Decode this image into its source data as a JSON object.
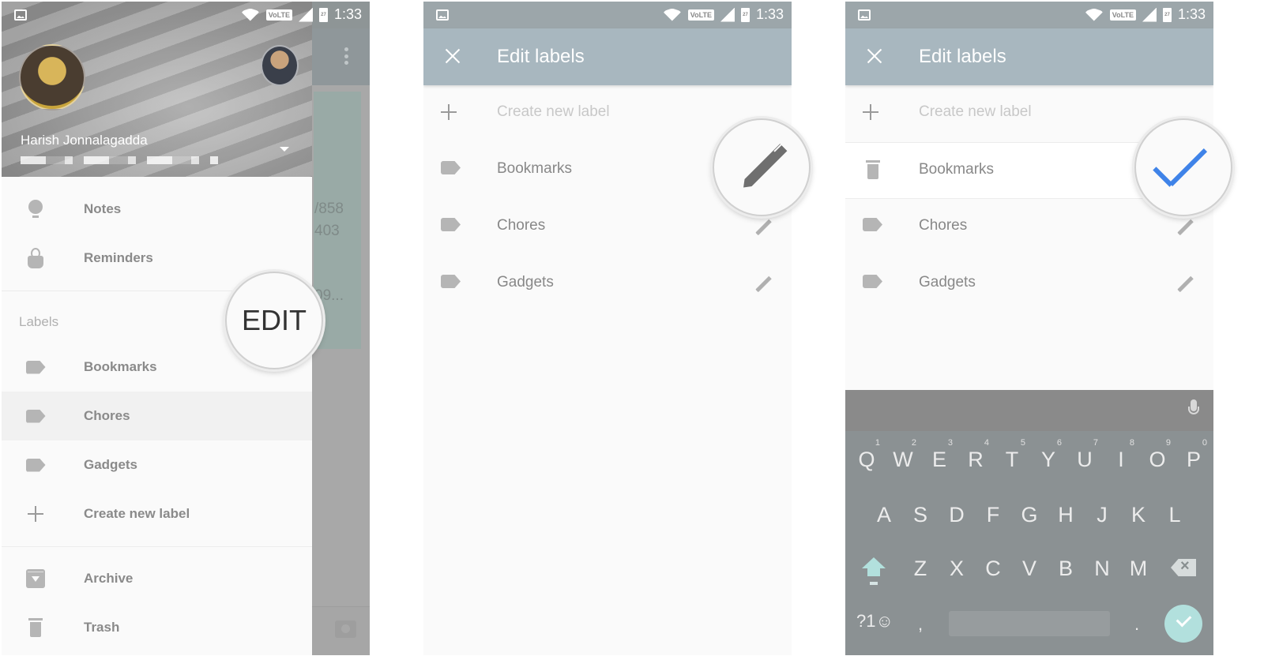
{
  "status_bar": {
    "network_badge": "VoLTE",
    "battery_level": "27",
    "time": "1:33"
  },
  "panel1": {
    "account": {
      "name": "Harish Jonnalagadda"
    },
    "nav_items": [
      {
        "label": "Notes",
        "icon": "lightbulb-icon"
      },
      {
        "label": "Reminders",
        "icon": "reminder-finger-icon"
      }
    ],
    "labels_section": {
      "title": "Labels",
      "edit_label": "EDIT"
    },
    "label_items": [
      {
        "label": "Bookmarks",
        "icon": "label-tag-icon"
      },
      {
        "label": "Chores",
        "icon": "label-tag-icon",
        "active": true
      },
      {
        "label": "Gadgets",
        "icon": "label-tag-icon"
      }
    ],
    "create_label": "Create new label",
    "bottom_items": [
      {
        "label": "Archive",
        "icon": "archive-icon"
      },
      {
        "label": "Trash",
        "icon": "trash-icon"
      }
    ],
    "background_note_fragments": [
      "/858",
      "403",
      "09..."
    ]
  },
  "panel2": {
    "title": "Edit labels",
    "create_placeholder": "Create new label",
    "labels": [
      "Bookmarks",
      "Chores",
      "Gadgets"
    ],
    "magnified_icon": "pencil-icon"
  },
  "panel3": {
    "title": "Edit labels",
    "create_placeholder": "Create new label",
    "labels": [
      "Bookmarks",
      "Chores",
      "Gadgets"
    ],
    "editing_label": "Bookmarks",
    "magnified_icon": "checkmark-icon",
    "accent_color": "#3f83e8",
    "keyboard": {
      "row1": [
        {
          "key": "Q",
          "hint": "1"
        },
        {
          "key": "W",
          "hint": "2"
        },
        {
          "key": "E",
          "hint": "3"
        },
        {
          "key": "R",
          "hint": "4"
        },
        {
          "key": "T",
          "hint": "5"
        },
        {
          "key": "Y",
          "hint": "6"
        },
        {
          "key": "U",
          "hint": "7"
        },
        {
          "key": "I",
          "hint": "8"
        },
        {
          "key": "O",
          "hint": "9"
        },
        {
          "key": "P",
          "hint": "0"
        }
      ],
      "row2": [
        "A",
        "S",
        "D",
        "F",
        "G",
        "H",
        "J",
        "K",
        "L"
      ],
      "row3": [
        "Z",
        "X",
        "C",
        "V",
        "B",
        "N",
        "M"
      ],
      "symbols_key": "?1☺",
      "comma_key": ",",
      "period_key": "."
    }
  }
}
